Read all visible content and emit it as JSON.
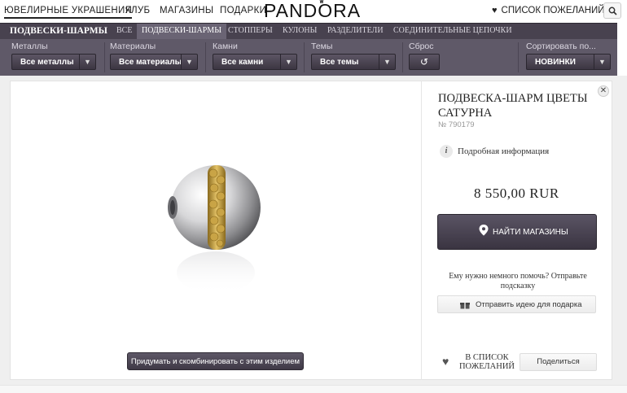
{
  "top_nav": {
    "items": [
      "Ювелирные украшения",
      "Клуб",
      "Магазины",
      "Подарки"
    ],
    "logo": "PANDORA",
    "wishlist": "Список пожеланий"
  },
  "category_bar": {
    "title": "Подвески-шармы",
    "tabs": [
      "Все",
      "Подвески-шармы",
      "Стопперы",
      "Кулоны",
      "Разделители",
      "Соединительные цепочки"
    ],
    "selected": "Подвески-шармы"
  },
  "filters": {
    "metals": {
      "label": "Металлы",
      "value": "Все металлы"
    },
    "materials": {
      "label": "Материалы",
      "value": "Все материалы"
    },
    "stones": {
      "label": "Камни",
      "value": "Все камни"
    },
    "themes": {
      "label": "Темы",
      "value": "Все темы"
    },
    "reset": {
      "label": "Сброс"
    },
    "sort": {
      "label": "Сортировать по...",
      "value": "Новинки"
    }
  },
  "product": {
    "title": "Подвеска-шарм цветы Сатурна",
    "sku": "№ 790179",
    "info_label": "Подробная информация",
    "price": "8 550,00 RUR",
    "find_stores": "Найти магазины",
    "help_text": "Ему нужно немного помочь? Отправьте подсказку",
    "gift_idea": "Отправить идею для подарка",
    "wishlist_add": "В список пожеланий",
    "share": "Поделиться",
    "combine": "Придумать и скомбинировать с этим изделием"
  },
  "colors": {
    "nav_dark": "#48424f",
    "filter_bg": "#5f5968",
    "button_dark": "#433d4a"
  }
}
